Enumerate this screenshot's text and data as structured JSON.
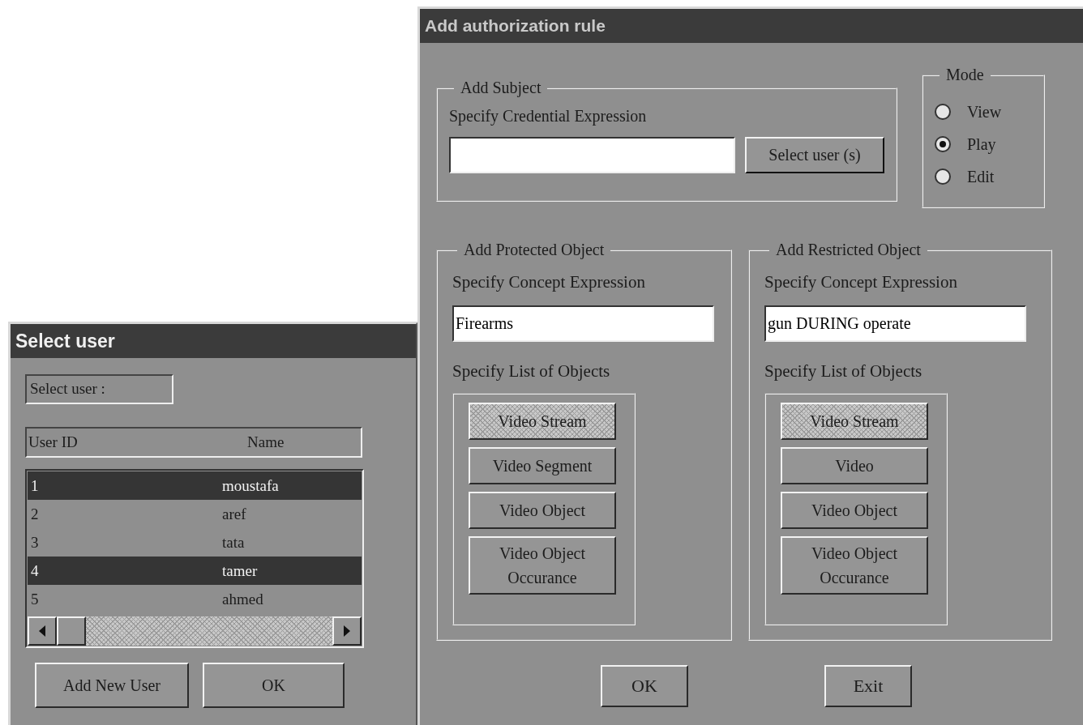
{
  "select_user_window": {
    "title": "Select user",
    "prompt": "Select user :",
    "columns": [
      "User ID",
      "Name"
    ],
    "rows": [
      {
        "id": "1",
        "name": "moustafa",
        "selected": true
      },
      {
        "id": "2",
        "name": "aref",
        "selected": false
      },
      {
        "id": "3",
        "name": "tata",
        "selected": false
      },
      {
        "id": "4",
        "name": "tamer",
        "selected": true
      },
      {
        "id": "5",
        "name": "ahmed",
        "selected": false
      }
    ],
    "buttons": [
      "Add New User",
      "OK"
    ]
  },
  "auth_window": {
    "title": "Add authorization rule",
    "subject": {
      "legend": "Add Subject",
      "label": "Specify Credential Expression",
      "button": "Select user (s)"
    },
    "mode": {
      "legend": "Mode",
      "options": [
        {
          "label": "View",
          "selected": false
        },
        {
          "label": "Play",
          "selected": true
        },
        {
          "label": "Edit",
          "selected": false
        }
      ]
    },
    "panels": [
      {
        "legend": "Add Protected Object",
        "concept_label": "Specify Concept Expression",
        "concept_value": "Firearms",
        "list_label": "Specify List of Objects",
        "objects": [
          {
            "label": "Video Stream",
            "selected": true
          },
          {
            "label": "Video Segment",
            "selected": false
          },
          {
            "label": "Video Object",
            "selected": false
          },
          {
            "label": "Video Object Occurance",
            "selected": false
          }
        ]
      },
      {
        "legend": "Add Restricted Object",
        "concept_label": "Specify Concept Expression",
        "concept_value": "gun DURING operate",
        "list_label": "Specify List of Objects",
        "objects": [
          {
            "label": "Video Stream",
            "selected": true
          },
          {
            "label": "Video",
            "selected": false
          },
          {
            "label": "Video Object",
            "selected": false
          },
          {
            "label": "Video Object Occurance",
            "selected": false
          }
        ]
      }
    ],
    "buttons": [
      "OK",
      "Exit"
    ]
  }
}
